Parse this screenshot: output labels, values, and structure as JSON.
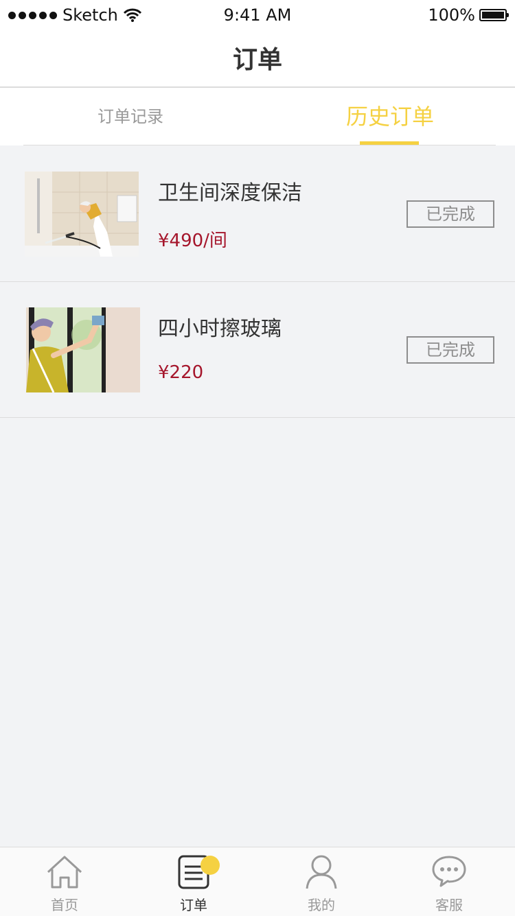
{
  "status_bar": {
    "carrier": "Sketch",
    "time": "9:41 AM",
    "battery": "100%"
  },
  "nav": {
    "title": "订单"
  },
  "tabs": [
    {
      "label": "订单记录",
      "active": false
    },
    {
      "label": "历史订单",
      "active": true
    }
  ],
  "orders": [
    {
      "title": "卫生间深度保洁",
      "price": "¥490/间",
      "status": "已完成"
    },
    {
      "title": "四小时擦玻璃",
      "price": "¥220",
      "status": "已完成"
    }
  ],
  "tabbar": [
    {
      "label": "首页",
      "icon": "home-icon",
      "active": false
    },
    {
      "label": "订单",
      "icon": "orders-icon",
      "active": true
    },
    {
      "label": "我的",
      "icon": "user-icon",
      "active": false
    },
    {
      "label": "客服",
      "icon": "chat-icon",
      "active": false
    }
  ],
  "colors": {
    "accent": "#f5d142",
    "price": "#a5152b",
    "background": "#f2f3f5"
  }
}
